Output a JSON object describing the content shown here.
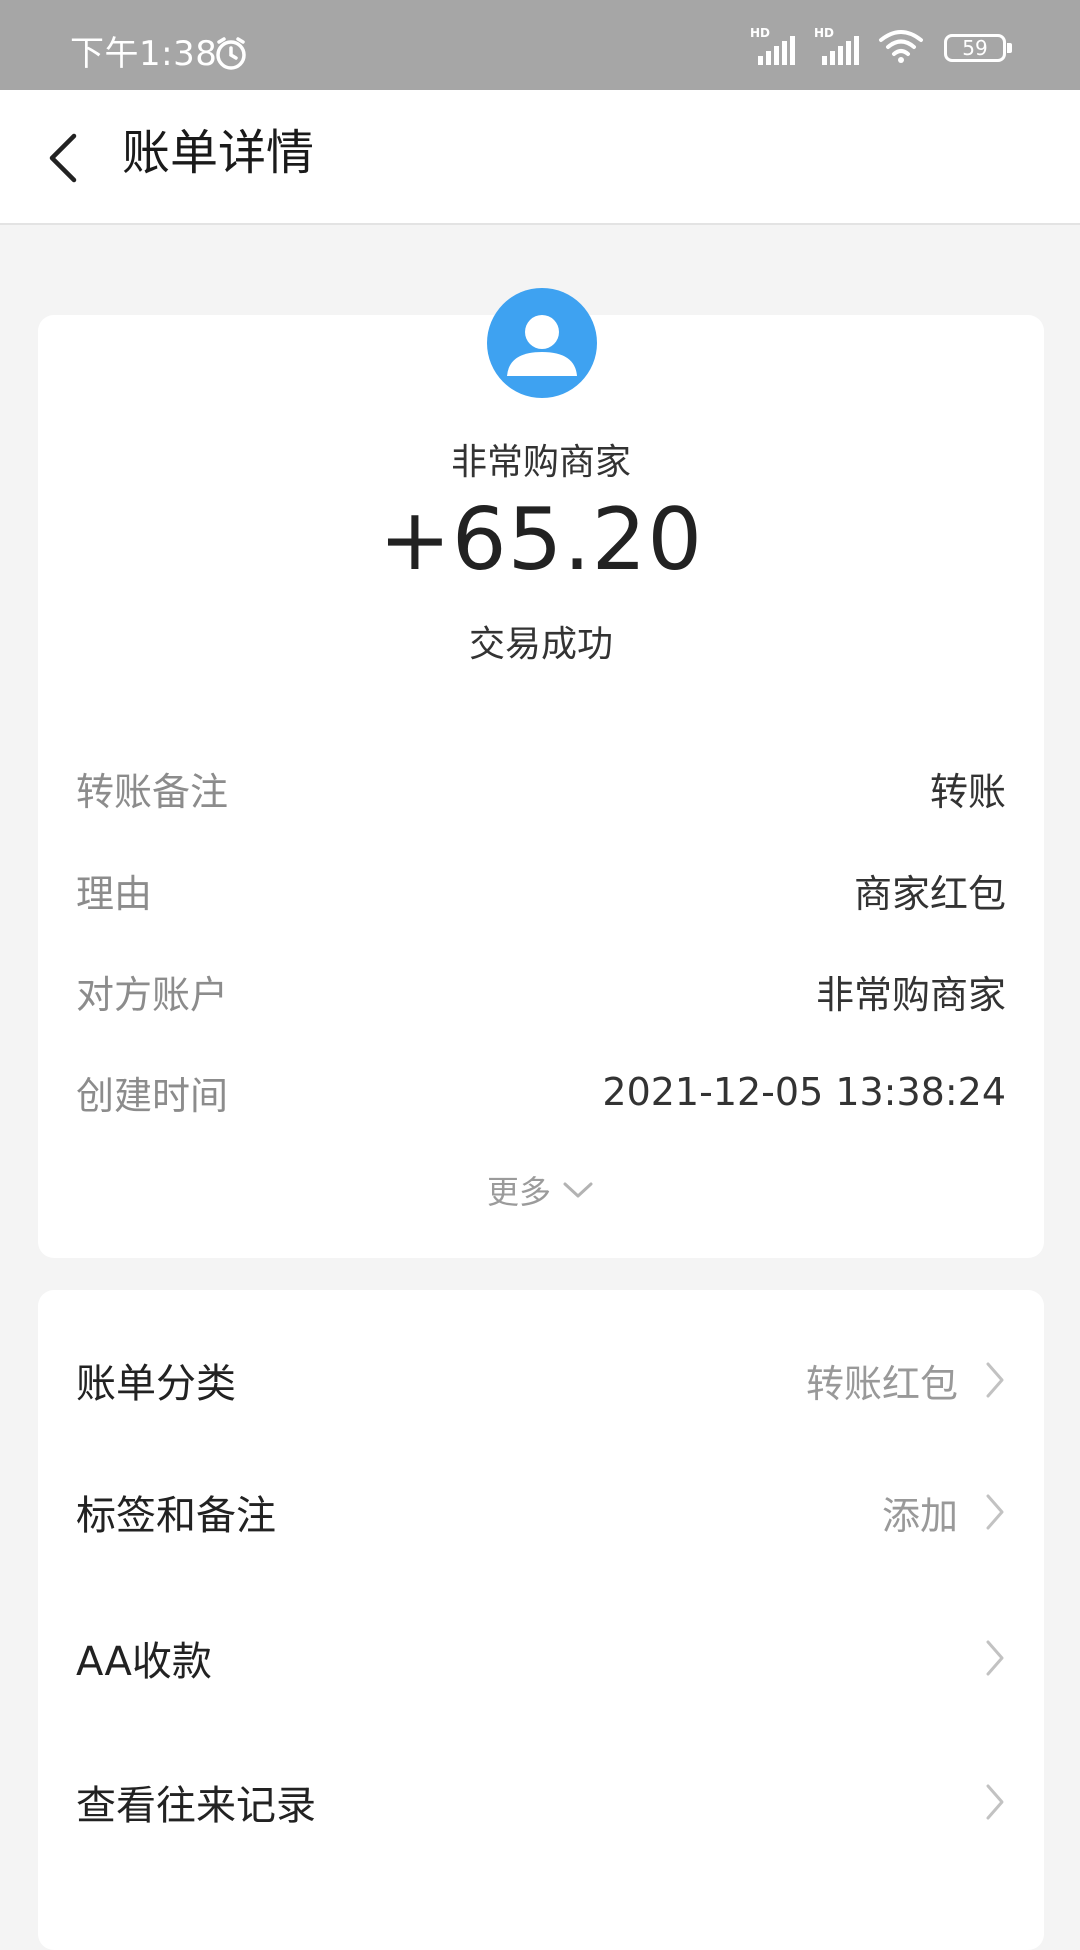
{
  "status_bar": {
    "time": "下午1:38",
    "hd_label": "HD",
    "battery": "59",
    "icons": [
      "alarm-icon",
      "signal-icon",
      "signal-icon",
      "wifi-icon",
      "battery-icon"
    ]
  },
  "header": {
    "title": "账单详情",
    "back_icon": "chevron-left-icon"
  },
  "detail": {
    "avatar_icon": "user-avatar-icon",
    "avatar_color": "#3ea2f1",
    "merchant": "非常购商家",
    "amount": "+65.20",
    "status": "交易成功",
    "rows": [
      {
        "label": "转账备注",
        "value": "转账"
      },
      {
        "label": "理由",
        "value": "商家红包"
      },
      {
        "label": "对方账户",
        "value": "非常购商家"
      },
      {
        "label": "创建时间",
        "value": "2021-12-05 13:38:24"
      }
    ],
    "more_label": "更多"
  },
  "actions": [
    {
      "label": "账单分类",
      "value": "转账红包"
    },
    {
      "label": "标签和备注",
      "value": "添加"
    },
    {
      "label": "AA收款",
      "value": ""
    },
    {
      "label": "查看往来记录",
      "value": ""
    }
  ]
}
